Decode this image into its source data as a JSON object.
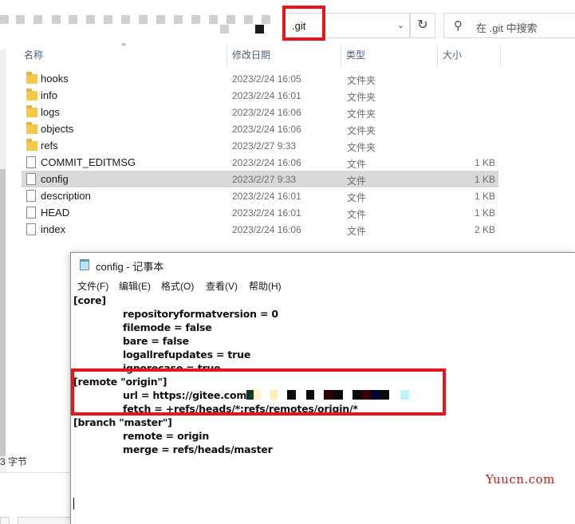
{
  "explorer": {
    "address": ".git",
    "search_placeholder": "在 .git 中搜索",
    "refresh_icon": "refresh-icon",
    "columns": {
      "name": "名称",
      "date": "修改日期",
      "type": "类型",
      "size": "大小"
    },
    "files": [
      {
        "name": "hooks",
        "date": "2023/2/24 16:05",
        "type": "文件夹",
        "size": "",
        "icon": "folder-icon"
      },
      {
        "name": "info",
        "date": "2023/2/24 16:01",
        "type": "文件夹",
        "size": "",
        "icon": "folder-icon"
      },
      {
        "name": "logs",
        "date": "2023/2/24 16:06",
        "type": "文件夹",
        "size": "",
        "icon": "folder-icon"
      },
      {
        "name": "objects",
        "date": "2023/2/24 16:06",
        "type": "文件夹",
        "size": "",
        "icon": "folder-icon"
      },
      {
        "name": "refs",
        "date": "2023/2/27 9:33",
        "type": "文件夹",
        "size": "",
        "icon": "folder-icon"
      },
      {
        "name": "COMMIT_EDITMSG",
        "date": "2023/2/24 16:06",
        "type": "文件",
        "size": "1 KB",
        "icon": "file-icon"
      },
      {
        "name": "config",
        "date": "2023/2/27 9:33",
        "type": "文件",
        "size": "1 KB",
        "icon": "file-icon",
        "selected": true
      },
      {
        "name": "description",
        "date": "2023/2/24 16:01",
        "type": "文件",
        "size": "1 KB",
        "icon": "file-icon"
      },
      {
        "name": "HEAD",
        "date": "2023/2/24 16:01",
        "type": "文件",
        "size": "1 KB",
        "icon": "file-icon"
      },
      {
        "name": "index",
        "date": "2023/2/24 16:06",
        "type": "文件",
        "size": "2 KB",
        "icon": "file-icon"
      }
    ],
    "status_text": "3 字节"
  },
  "notepad": {
    "title": "config - 记事本",
    "menu": [
      "文件(F)",
      "编辑(E)",
      "格式(O)",
      "查看(V)",
      "帮助(H)"
    ],
    "lines": [
      {
        "indent": false,
        "text": "[core]"
      },
      {
        "indent": true,
        "text": "repositoryformatversion = 0"
      },
      {
        "indent": true,
        "text": "filemode = false"
      },
      {
        "indent": true,
        "text": "bare = false"
      },
      {
        "indent": true,
        "text": "logallrefupdates = true"
      },
      {
        "indent": true,
        "text": "ignorecase = true"
      },
      {
        "indent": false,
        "text": "[remote \"origin\"]"
      },
      {
        "indent": true,
        "text": "url = https://gitee.com"
      },
      {
        "indent": true,
        "text": "fetch = +refs/heads/*:refs/remotes/origin/*"
      },
      {
        "indent": false,
        "text": "[branch \"master\"]"
      },
      {
        "indent": true,
        "text": "remote = origin"
      },
      {
        "indent": true,
        "text": "merge = refs/heads/master"
      }
    ]
  },
  "watermark": "Yuucn.com",
  "colors": {
    "highlight_red": "#e8141b",
    "selection_gray": "#d9d9d9",
    "folder_yellow": "#f5c84c",
    "watermark_red": "#c21c1c"
  }
}
